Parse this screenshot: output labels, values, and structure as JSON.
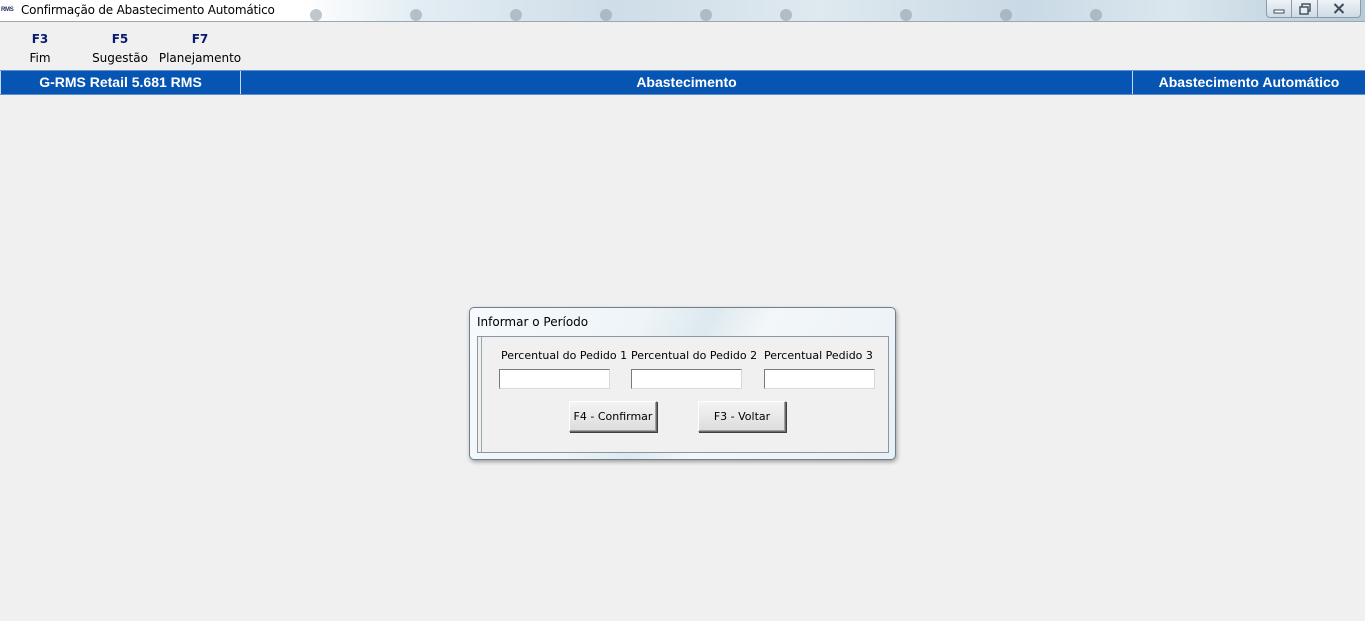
{
  "window": {
    "title": "Confirmação de Abastecimento Automático",
    "app_icon_text": "RMS",
    "controls": [
      "minimize-icon",
      "maximize-icon",
      "close-icon"
    ]
  },
  "function_keys": [
    {
      "key": "F3",
      "label": "Fim"
    },
    {
      "key": "F5",
      "label": "Sugestão"
    },
    {
      "key": "F7",
      "label": "Planejamento"
    }
  ],
  "header": {
    "product": "G-RMS Retail 5.681 RMS",
    "module": "Abastecimento",
    "screen": "Abastecimento Automático",
    "color": "#0755b3"
  },
  "dialog": {
    "title": "Informar o Período",
    "fields": [
      {
        "label": "Percentual do Pedido 1",
        "value": ""
      },
      {
        "label": "Percentual do Pedido 2",
        "value": ""
      },
      {
        "label": "Percentual Pedido 3",
        "value": ""
      }
    ],
    "buttons": {
      "confirm": "F4 - Confirmar",
      "back": "F3 - Voltar"
    }
  }
}
